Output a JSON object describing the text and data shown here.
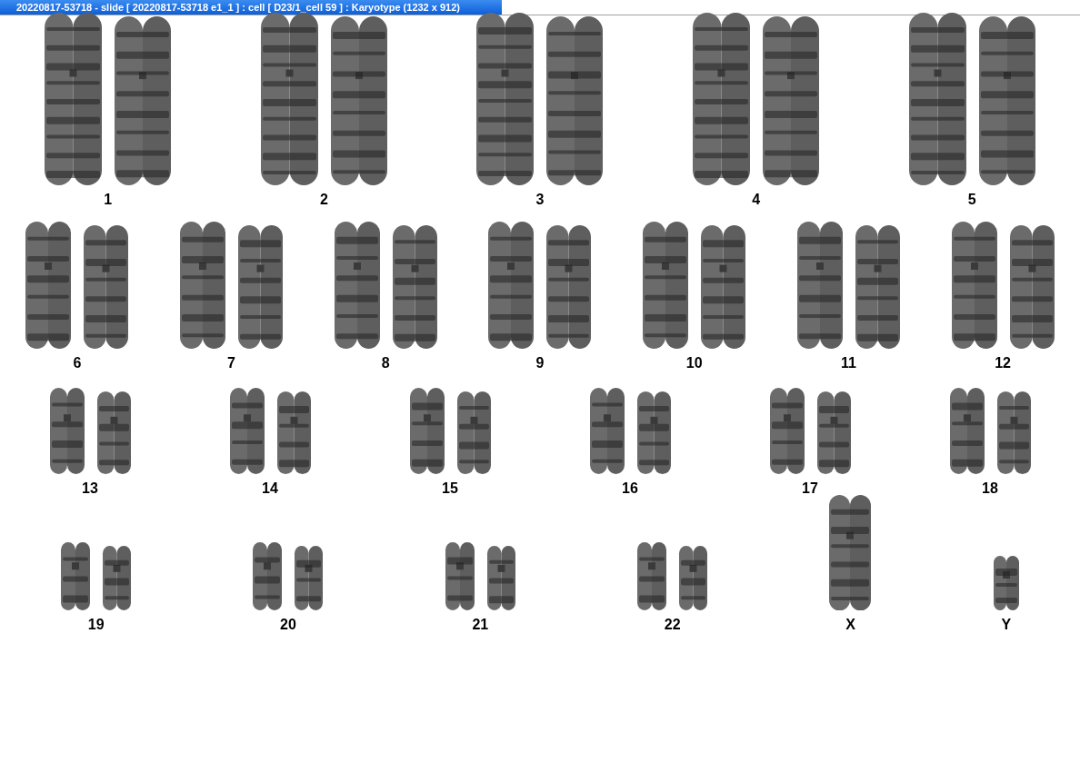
{
  "window": {
    "title": "20220817-53718 - slide [ 20220817-53718 e1_1 ] : cell [ D23/1_cell 59 ] : Karyotype  (1232 x 912)"
  },
  "karyotype": {
    "rows": [
      {
        "pairs": [
          {
            "label": "1",
            "kind": "pair"
          },
          {
            "label": "2",
            "kind": "pair"
          },
          {
            "label": "3",
            "kind": "pair"
          },
          {
            "label": "4",
            "kind": "pair"
          },
          {
            "label": "5",
            "kind": "pair"
          }
        ]
      },
      {
        "pairs": [
          {
            "label": "6",
            "kind": "pair"
          },
          {
            "label": "7",
            "kind": "pair"
          },
          {
            "label": "8",
            "kind": "pair"
          },
          {
            "label": "9",
            "kind": "pair"
          },
          {
            "label": "10",
            "kind": "pair"
          },
          {
            "label": "11",
            "kind": "pair"
          },
          {
            "label": "12",
            "kind": "pair"
          }
        ]
      },
      {
        "pairs": [
          {
            "label": "13",
            "kind": "pair"
          },
          {
            "label": "14",
            "kind": "pair"
          },
          {
            "label": "15",
            "kind": "pair"
          },
          {
            "label": "16",
            "kind": "pair"
          },
          {
            "label": "17",
            "kind": "pair"
          },
          {
            "label": "18",
            "kind": "pair"
          }
        ]
      },
      {
        "pairs": [
          {
            "label": "19",
            "kind": "pair"
          },
          {
            "label": "20",
            "kind": "pair"
          },
          {
            "label": "21",
            "kind": "pair"
          },
          {
            "label": "22",
            "kind": "pair"
          },
          {
            "label": "X",
            "kind": "long"
          },
          {
            "label": "Y",
            "kind": "short"
          }
        ]
      }
    ]
  }
}
